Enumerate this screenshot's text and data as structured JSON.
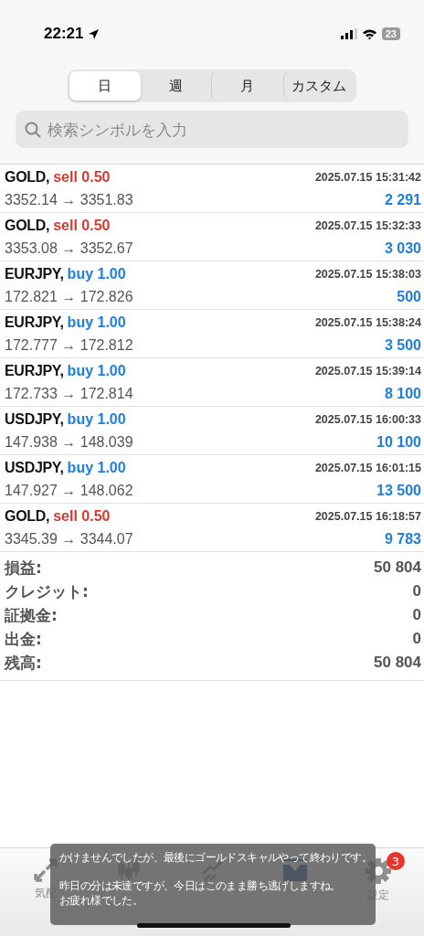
{
  "status_bar": {
    "time": "22:21",
    "battery": "23"
  },
  "period_tabs": [
    {
      "label": "日",
      "selected": true
    },
    {
      "label": "週",
      "selected": false
    },
    {
      "label": "月",
      "selected": false
    },
    {
      "label": "カスタム",
      "selected": false
    }
  ],
  "search": {
    "placeholder": "検索シンボルを入力"
  },
  "trades": [
    {
      "symbol": "GOLD,",
      "side": "sell",
      "volume": "0.50",
      "prices": "3352.14 → 3351.83",
      "time": "2025.07.15 15:31:42",
      "profit": "2 291"
    },
    {
      "symbol": "GOLD,",
      "side": "sell",
      "volume": "0.50",
      "prices": "3353.08 → 3352.67",
      "time": "2025.07.15 15:32:33",
      "profit": "3 030"
    },
    {
      "symbol": "EURJPY,",
      "side": "buy",
      "volume": "1.00",
      "prices": "172.821 → 172.826",
      "time": "2025.07.15 15:38:03",
      "profit": "500"
    },
    {
      "symbol": "EURJPY,",
      "side": "buy",
      "volume": "1.00",
      "prices": "172.777 → 172.812",
      "time": "2025.07.15 15:38:24",
      "profit": "3 500"
    },
    {
      "symbol": "EURJPY,",
      "side": "buy",
      "volume": "1.00",
      "prices": "172.733 → 172.814",
      "time": "2025.07.15 15:39:14",
      "profit": "8 100"
    },
    {
      "symbol": "USDJPY,",
      "side": "buy",
      "volume": "1.00",
      "prices": "147.938 → 148.039",
      "time": "2025.07.15 16:00:33",
      "profit": "10 100"
    },
    {
      "symbol": "USDJPY,",
      "side": "buy",
      "volume": "1.00",
      "prices": "147.927 → 148.062",
      "time": "2025.07.15 16:01:15",
      "profit": "13 500"
    },
    {
      "symbol": "GOLD,",
      "side": "sell",
      "volume": "0.50",
      "prices": "3345.39 → 3344.07",
      "time": "2025.07.15 16:18:57",
      "profit": "9 783"
    }
  ],
  "summary": [
    {
      "label": "損益:",
      "value": "50 804"
    },
    {
      "label": "クレジット:",
      "value": "0"
    },
    {
      "label": "証拠金:",
      "value": "0"
    },
    {
      "label": "出金:",
      "value": "0"
    },
    {
      "label": "残高:",
      "value": "50 804"
    }
  ],
  "tab_bar": [
    {
      "kind": "quotes",
      "label": "気配",
      "selected": false
    },
    {
      "kind": "chart",
      "selected": false
    },
    {
      "kind": "trade",
      "selected": false
    },
    {
      "kind": "history",
      "selected": true
    },
    {
      "kind": "settings",
      "label": "設定",
      "selected": false,
      "badge": "3"
    }
  ],
  "caption": {
    "lines": [
      "かけませんでしたが、最後にゴールドスキャルやって終わりです。",
      "昨日の分は未達ですが、今日はこのまま勝ち逃げしますね。",
      "お疲れ様でした。"
    ]
  }
}
